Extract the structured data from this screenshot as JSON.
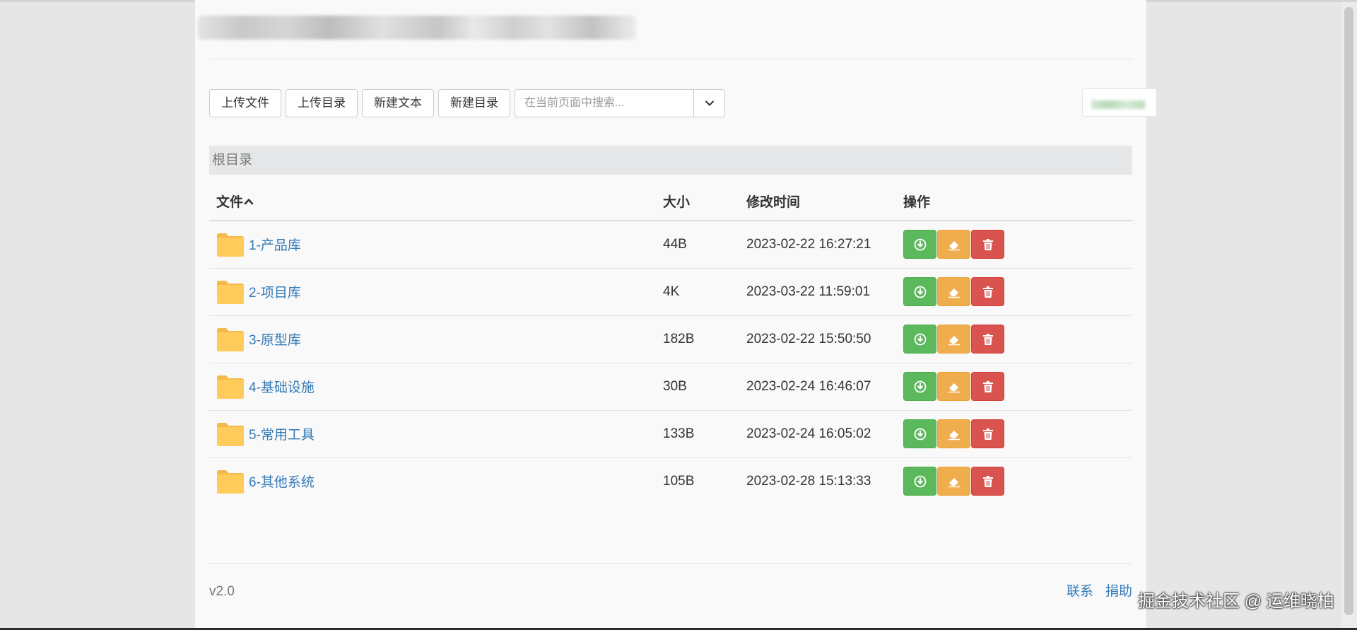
{
  "toolbar": {
    "upload_file": "上传文件",
    "upload_dir": "上传目录",
    "new_text": "新建文本",
    "new_dir": "新建目录"
  },
  "search": {
    "placeholder": "在当前页面中搜索...",
    "value": ""
  },
  "breadcrumb": {
    "root": "根目录"
  },
  "table": {
    "headers": {
      "file": "文件",
      "size": "大小",
      "modified": "修改时间",
      "actions": "操作"
    },
    "sort_indicator": "chevron-up-icon",
    "rows": [
      {
        "name": "1-产品库",
        "size": "44B",
        "modified": "2023-02-22 16:27:21"
      },
      {
        "name": "2-项目库",
        "size": "4K",
        "modified": "2023-03-22 11:59:01"
      },
      {
        "name": "3-原型库",
        "size": "182B",
        "modified": "2023-02-22 15:50:50"
      },
      {
        "name": "4-基础设施",
        "size": "30B",
        "modified": "2023-02-24 16:46:07"
      },
      {
        "name": "5-常用工具",
        "size": "133B",
        "modified": "2023-02-24 16:05:02"
      },
      {
        "name": "6-其他系统",
        "size": "105B",
        "modified": "2023-02-28 15:13:33"
      }
    ]
  },
  "icons": {
    "folder": "folder-icon",
    "download": "download-icon",
    "rename": "eraser-icon",
    "delete": "trash-icon",
    "dropdown": "chevron-down-icon"
  },
  "colors": {
    "download_button": "#5cb85c",
    "rename_button": "#f0ad4e",
    "delete_button": "#d9534f",
    "link": "#337ab7",
    "folder": "#ffcc5c"
  },
  "footer": {
    "version": "v2.0",
    "contact": "联系",
    "donate": "捐助"
  },
  "watermark": "掘金技术社区 @ 运维晓柏"
}
